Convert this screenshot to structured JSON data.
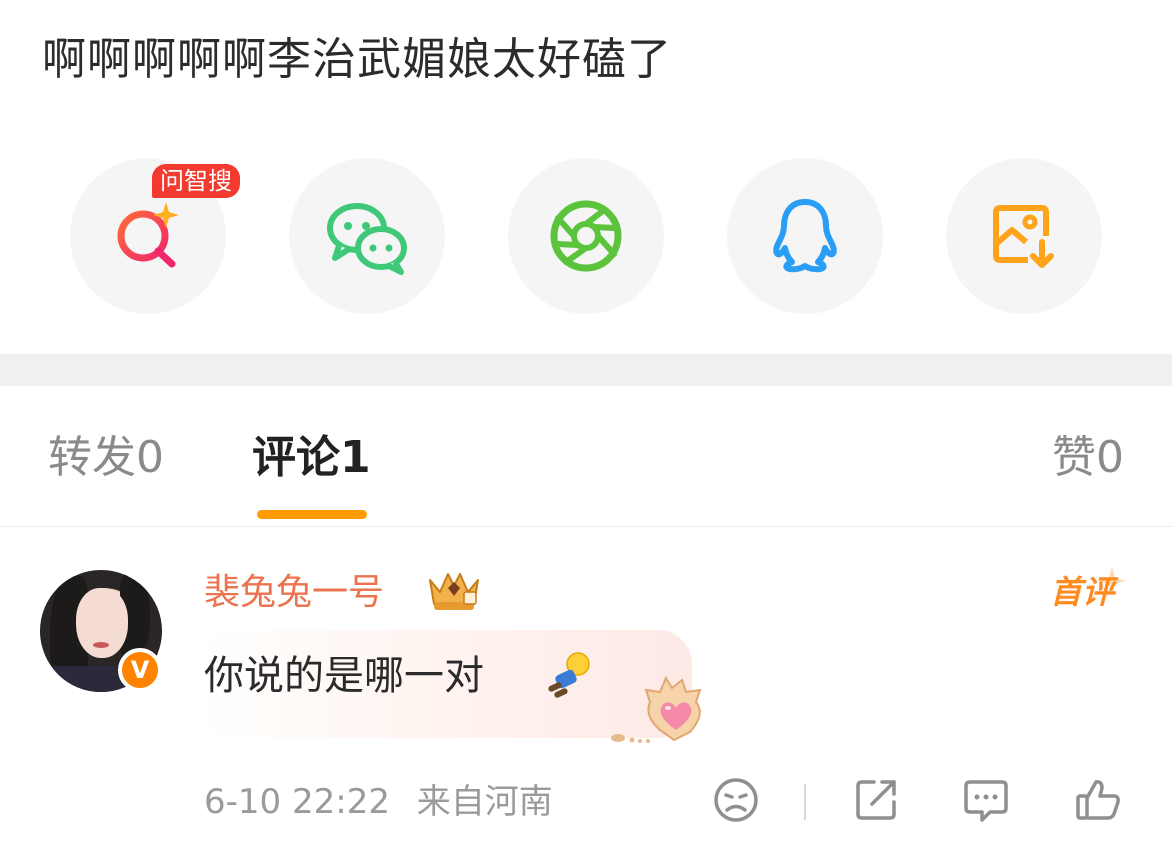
{
  "post": {
    "text": "啊啊啊啊啊李治武媚娘太好磕了"
  },
  "share": {
    "ai_badge": "问智搜",
    "items": [
      {
        "name": "ai-search",
        "icon": "ai-search-icon",
        "color": "#f23a5a"
      },
      {
        "name": "wechat",
        "icon": "wechat-icon",
        "color": "#3ec878"
      },
      {
        "name": "moments",
        "icon": "wechat-moments-icon",
        "color": "#5bc43c"
      },
      {
        "name": "qq",
        "icon": "qq-icon",
        "color": "#2a9df4"
      },
      {
        "name": "save-image",
        "icon": "save-image-icon",
        "color": "#ffa31a"
      }
    ]
  },
  "tabs": {
    "repost": "转发",
    "repost_count": "0",
    "comment": "评论",
    "comment_count": "1",
    "like": "赞",
    "like_count": "0",
    "active": "comment",
    "accent_color": "#ff9a00"
  },
  "comment": {
    "username": "裴兔兔一号",
    "verified_badge": "V",
    "first_comment_label": "首评",
    "text": "你说的是哪一对",
    "time": "6-10 22:22",
    "location": "来自河南",
    "username_color": "#eb7350"
  }
}
